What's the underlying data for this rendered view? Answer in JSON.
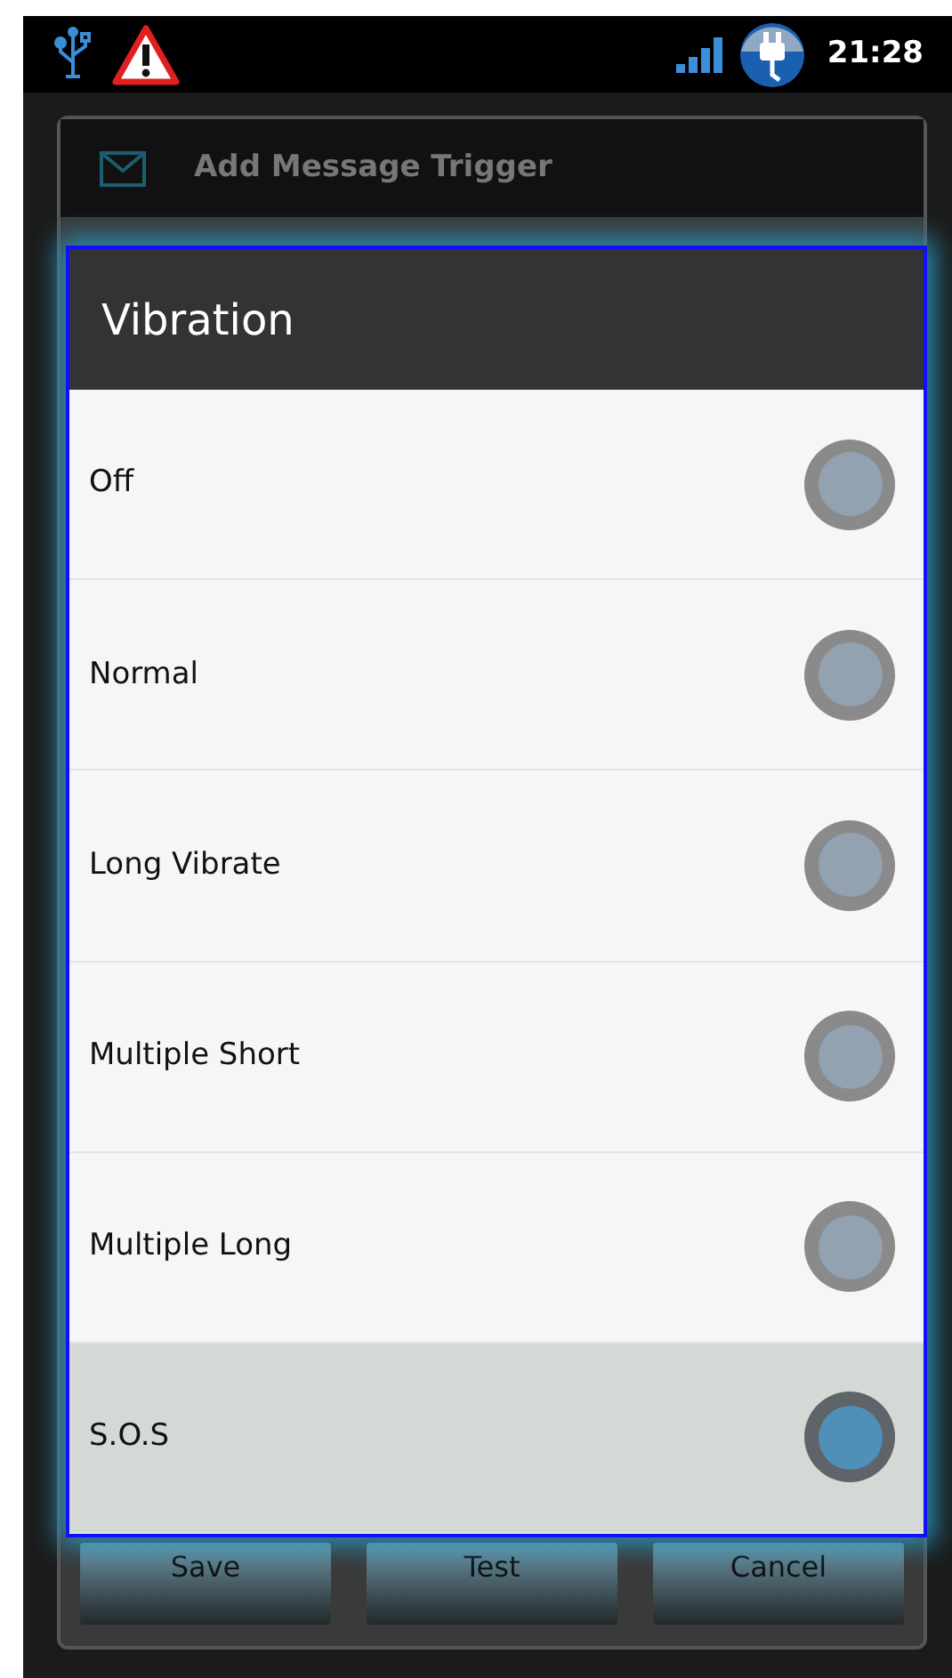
{
  "status_bar": {
    "time": "21:28"
  },
  "background_dialog": {
    "title": "Add Message Trigger",
    "buttons": [
      "Save",
      "Test",
      "Cancel"
    ]
  },
  "vibration_dialog": {
    "title": "Vibration",
    "options": [
      {
        "label": "Off",
        "selected": false
      },
      {
        "label": "Normal",
        "selected": false
      },
      {
        "label": "Long Vibrate",
        "selected": false
      },
      {
        "label": "Multiple Short",
        "selected": false
      },
      {
        "label": "Multiple Long",
        "selected": false
      },
      {
        "label": "S.O.S",
        "selected": true
      }
    ]
  }
}
